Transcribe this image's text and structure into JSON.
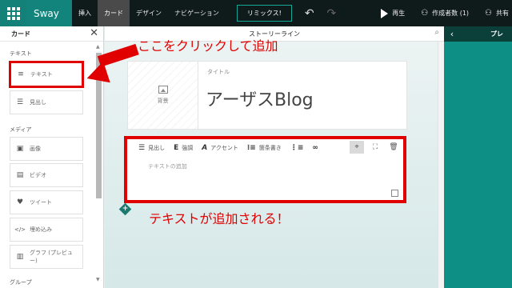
{
  "app": {
    "name": "Sway"
  },
  "menu_tabs": [
    "挿入",
    "カード",
    "デザイン",
    "ナビゲーション"
  ],
  "active_tab": "カード",
  "remix_label": "リミックス!",
  "toolbar_right": {
    "play": "再生",
    "authors": "作成者数 (1)",
    "share": "共有"
  },
  "panel": {
    "title": "カード",
    "sections": {
      "text": "テキスト",
      "media": "メディア",
      "group": "グループ"
    },
    "text_cards": [
      "テキスト",
      "見出し"
    ],
    "media_cards": [
      "画像",
      "ビデオ",
      "ツイート",
      "埋め込み",
      "グラフ (プレビュー)"
    ]
  },
  "storyline": {
    "title": "ストーリーライン",
    "title_card": {
      "label": "タイトル",
      "bg_label": "背景",
      "text": "アーザスBlog"
    },
    "text_card": {
      "toolbar": [
        "見出し",
        "強調",
        "アクセント",
        "箇条書き"
      ],
      "placeholder": "テキストの追加"
    }
  },
  "preview": {
    "title": "プレ"
  },
  "annotations": {
    "click_here": "ここをクリックして追加",
    "added": "テキストが追加される！"
  },
  "colors": {
    "highlight": "#e00000",
    "teal": "#12847b",
    "preview": "#0d8f85"
  }
}
